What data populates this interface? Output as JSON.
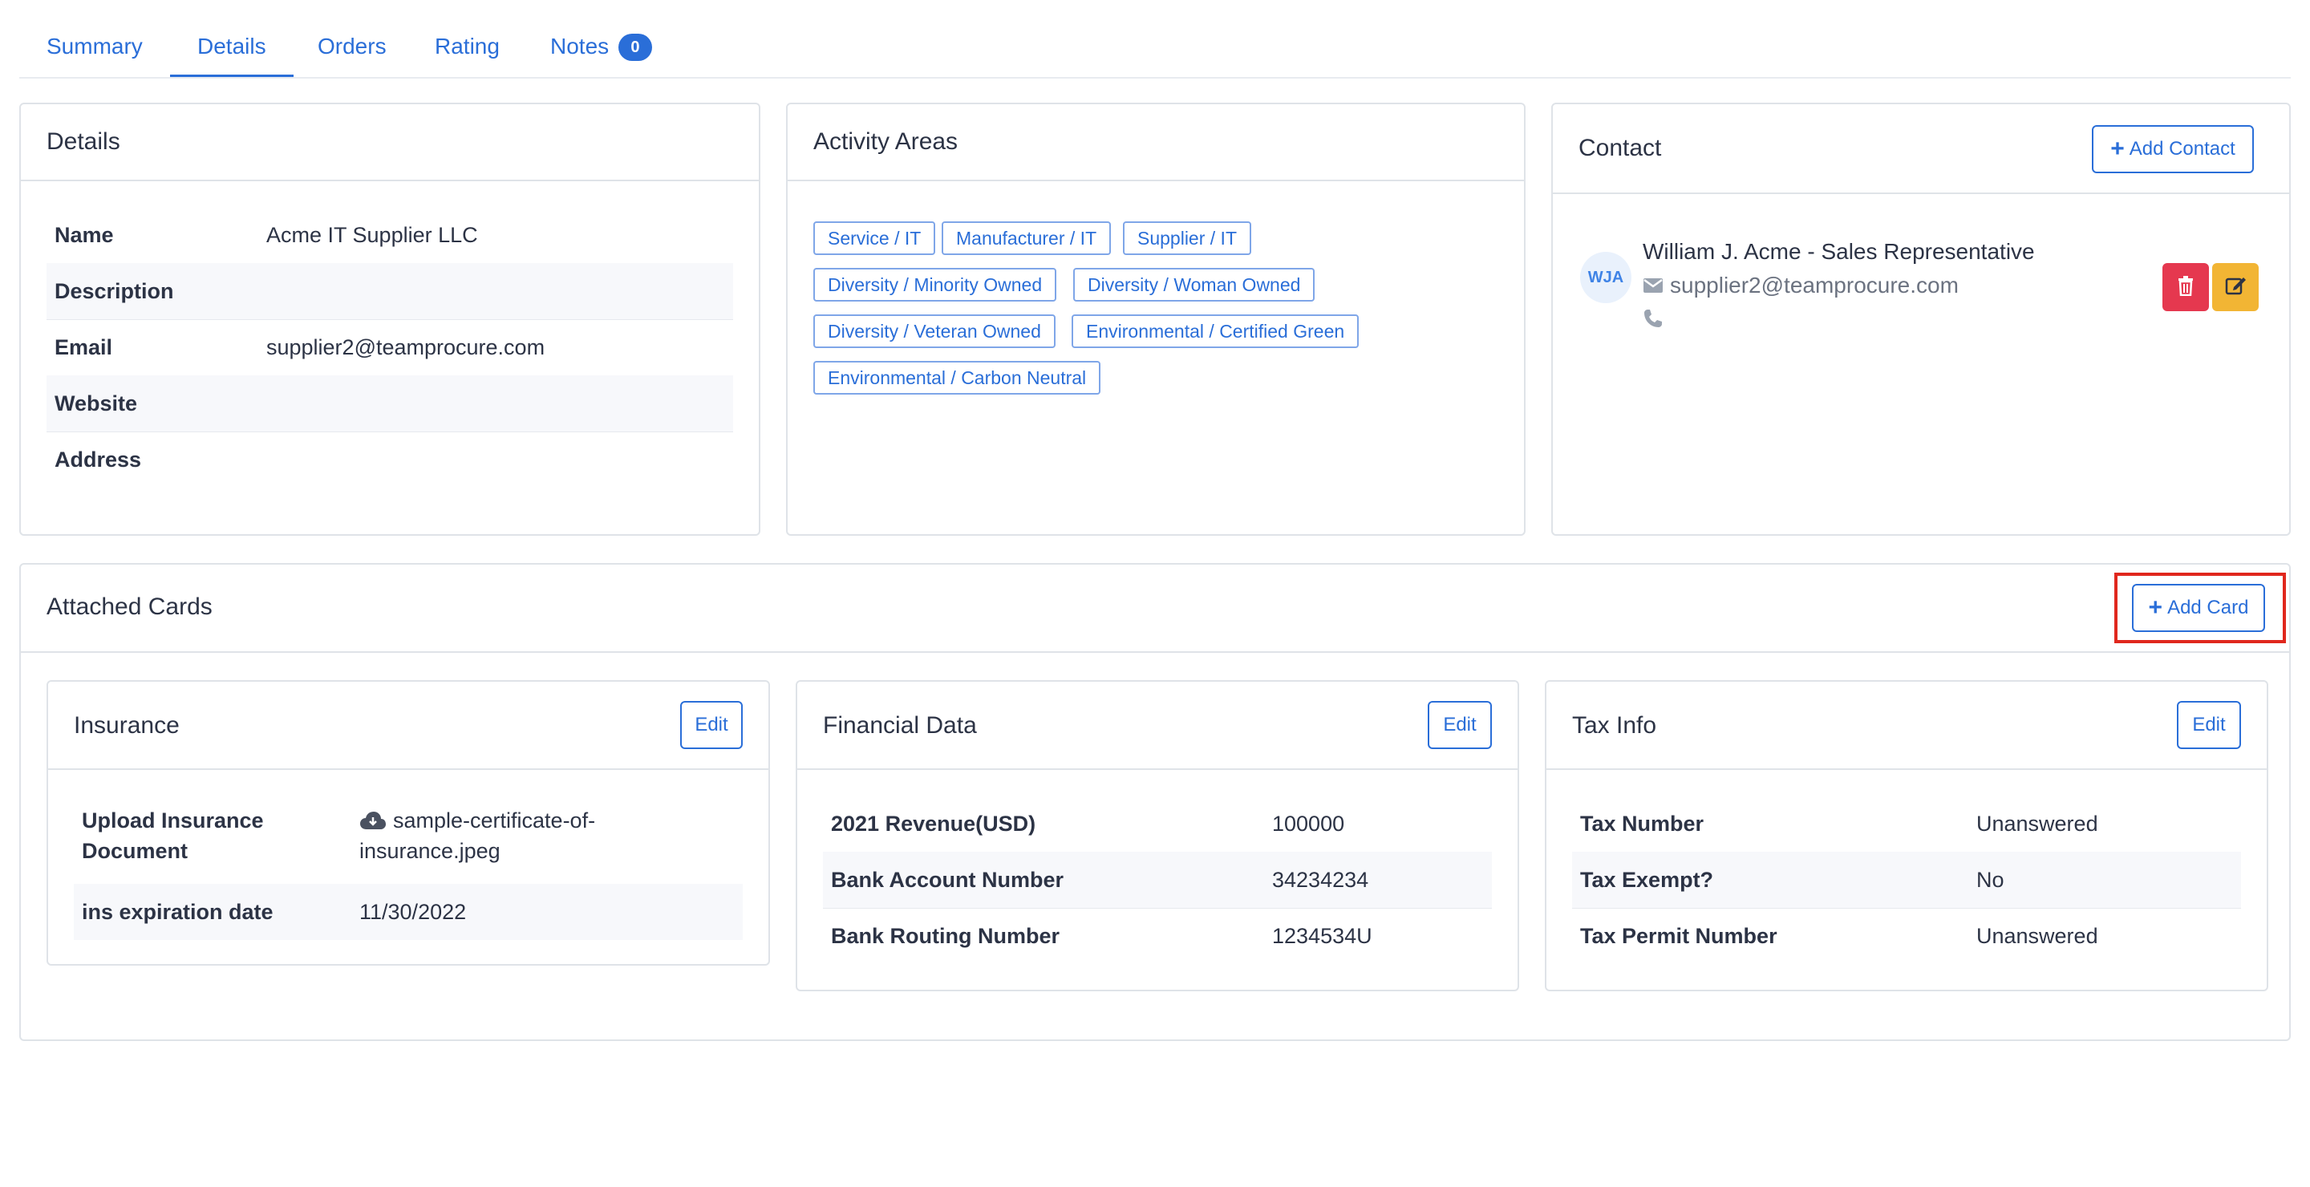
{
  "tabs": [
    {
      "label": "Summary"
    },
    {
      "label": "Details"
    },
    {
      "label": "Orders"
    },
    {
      "label": "Rating"
    },
    {
      "label": "Notes",
      "badge": "0"
    }
  ],
  "details": {
    "title": "Details",
    "rows": [
      {
        "key": "Name",
        "value": "Acme IT Supplier LLC"
      },
      {
        "key": "Description",
        "value": ""
      },
      {
        "key": "Email",
        "value": "supplier2@teamprocure.com"
      },
      {
        "key": "Website",
        "value": ""
      },
      {
        "key": "Address",
        "value": ""
      }
    ]
  },
  "activity": {
    "title": "Activity Areas",
    "tags": [
      "Service / IT",
      "Manufacturer / IT",
      "Supplier / IT",
      "Diversity / Minority Owned",
      "Diversity / Woman Owned",
      "Diversity / Veteran Owned",
      "Environmental / Certified Green",
      "Environmental / Carbon Neutral"
    ]
  },
  "contact": {
    "title": "Contact",
    "add_label": "Add Contact",
    "avatar_initials": "WJA",
    "name": "William J. Acme - Sales Representative",
    "email": "supplier2@teamprocure.com",
    "icons": [
      "envelope-icon",
      "phone-icon",
      "trash-icon",
      "edit-icon"
    ]
  },
  "attached": {
    "title": "Attached Cards",
    "add_label": "Add Card",
    "insurance": {
      "title": "Insurance",
      "edit_label": "Edit",
      "rows": [
        {
          "key_line1": "Upload Insurance",
          "key_line2": "Document",
          "value_line1": "sample-certificate-of-",
          "value_line2": "insurance.jpeg"
        },
        {
          "key": "ins expiration date",
          "value": "11/30/2022"
        }
      ]
    },
    "financial": {
      "title": "Financial Data",
      "edit_label": "Edit",
      "rows": [
        {
          "key": "2021 Revenue(USD)",
          "value": "100000"
        },
        {
          "key": "Bank Account Number",
          "value": "34234234"
        },
        {
          "key": "Bank Routing Number",
          "value": "1234534U"
        }
      ]
    },
    "tax": {
      "title": "Tax Info",
      "edit_label": "Edit",
      "rows": [
        {
          "key": "Tax Number",
          "value": "Unanswered"
        },
        {
          "key": "Tax Exempt?",
          "value": "No"
        },
        {
          "key": "Tax Permit Number",
          "value": "Unanswered"
        }
      ]
    }
  },
  "colors": {
    "accent": "#2a6ed8",
    "danger": "#e5384f",
    "warning": "#f2b534",
    "highlight": "#e0271d"
  }
}
